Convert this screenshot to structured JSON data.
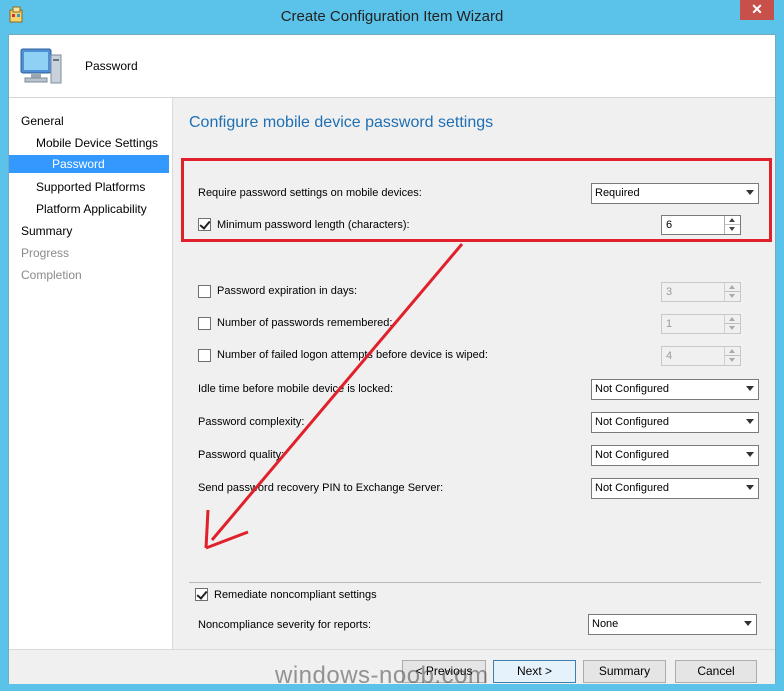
{
  "window": {
    "title": "Create Configuration Item Wizard",
    "close_label": "✕"
  },
  "header": {
    "title": "Password"
  },
  "nav": {
    "items": [
      {
        "label": "General",
        "state": "normal"
      },
      {
        "label": "Mobile Device Settings",
        "state": "normal"
      },
      {
        "label": "Password",
        "state": "selected"
      },
      {
        "label": "Supported Platforms",
        "state": "normal"
      },
      {
        "label": "Platform Applicability",
        "state": "normal"
      },
      {
        "label": "Summary",
        "state": "normal"
      },
      {
        "label": "Progress",
        "state": "disabled"
      },
      {
        "label": "Completion",
        "state": "disabled"
      }
    ]
  },
  "content": {
    "heading": "Configure mobile device password settings",
    "require_password": {
      "label": "Require password settings on mobile devices:",
      "value": "Required"
    },
    "min_length": {
      "label": "Minimum password length (characters):",
      "checked": true,
      "value": "6"
    },
    "expiration": {
      "label": "Password expiration in days:",
      "checked": false,
      "value": "3"
    },
    "remembered": {
      "label": "Number of passwords remembered:",
      "checked": false,
      "value": "1"
    },
    "failed_logon": {
      "label": "Number of failed logon attempts before device is wiped:",
      "checked": false,
      "value": "4"
    },
    "idle_time": {
      "label": "Idle time before mobile device is locked:",
      "value": "Not Configured"
    },
    "complexity": {
      "label": "Password complexity:",
      "value": "Not Configured"
    },
    "quality": {
      "label": "Password quality:",
      "value": "Not Configured"
    },
    "recovery_pin": {
      "label": "Send password recovery PIN to Exchange Server:",
      "value": "Not Configured"
    },
    "remediate": {
      "label": "Remediate noncompliant settings",
      "checked": true
    },
    "severity": {
      "label": "Noncompliance severity for reports:",
      "value": "None"
    }
  },
  "footer": {
    "previous": "< Previous",
    "next": "Next >",
    "summary": "Summary",
    "cancel": "Cancel"
  },
  "watermark": "windows-noob.com",
  "colors": {
    "titlebar": "#5bc3ea",
    "accent": "#1f6fb4",
    "selection": "#3399ff",
    "annotation": "#e0202a"
  }
}
